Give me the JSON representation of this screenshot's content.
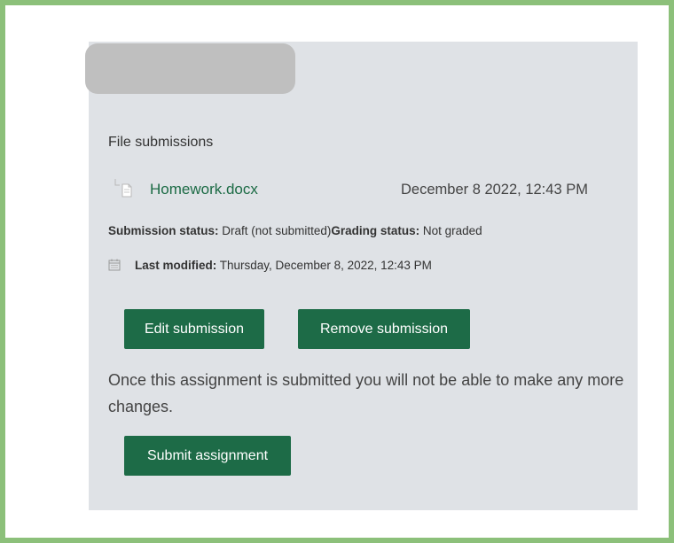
{
  "submission": {
    "section_label": "File submissions",
    "file": {
      "name": "Homework.docx",
      "date": "December 8 2022, 12:43 PM"
    },
    "status_label": "Submission status:",
    "status_value": "Draft (not submitted)",
    "grading_label": "Grading status:",
    "grading_value": "Not graded",
    "modified_label": "Last modified:",
    "modified_value": "Thursday, December 8, 2022, 12:43 PM"
  },
  "actions": {
    "edit_label": "Edit submission",
    "remove_label": "Remove submission",
    "submit_label": "Submit assignment"
  },
  "notice": "Once this assignment is submitted you will not be able to make any more changes.",
  "icons": {
    "file_tree": "file-tree-icon",
    "calendar": "calendar-icon"
  },
  "colors": {
    "frame_border": "#8cc07a",
    "panel_bg": "#dfe2e6",
    "button_bg": "#1d6b47",
    "link": "#1c6b45"
  }
}
